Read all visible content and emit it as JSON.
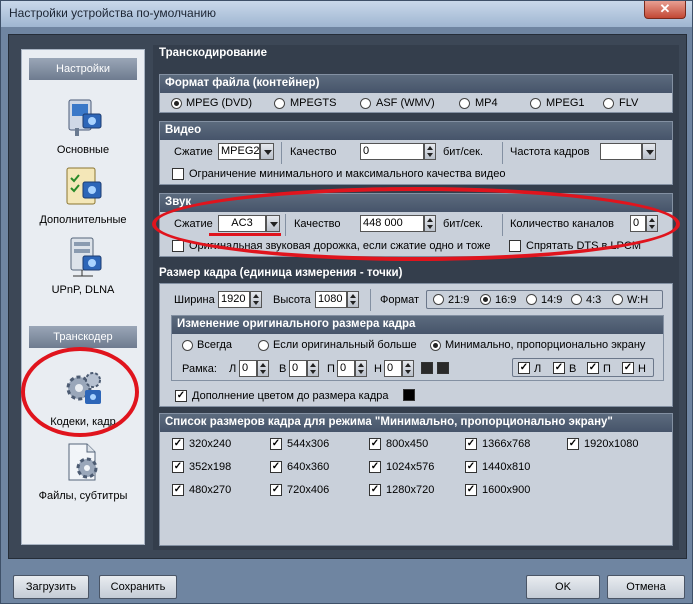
{
  "window": {
    "title": "Настройки устройства по-умолчанию",
    "close": "✕"
  },
  "sidebar": {
    "section1": "Настройки",
    "items": [
      {
        "label": "Основные",
        "icon": "media-settings-icon"
      },
      {
        "label": "Дополнительные",
        "icon": "checklist-icon"
      },
      {
        "label": "UPnP, DLNA",
        "icon": "network-server-icon"
      }
    ],
    "section2": "Транскодер",
    "items2": [
      {
        "label": "Кодеки, кадр",
        "icon": "gears-icon"
      },
      {
        "label": "Файлы, субтитры",
        "icon": "file-gear-icon"
      }
    ]
  },
  "main": {
    "title": "Транскодирование",
    "format": {
      "title": "Формат файла (контейнер)",
      "options": [
        "MPEG (DVD)",
        "MPEGTS",
        "ASF (WMV)",
        "MP4",
        "MPEG1",
        "FLV"
      ],
      "selected": "MPEG (DVD)"
    },
    "video": {
      "title": "Видео",
      "compress_label": "Сжатие",
      "compress_value": "MPEG2",
      "quality_label": "Качество",
      "quality_value": "0",
      "quality_unit": "бит/сек.",
      "fps_label": "Частота кадров",
      "fps_value": "",
      "limit_label": "Ограничение минимального и максимального качества видео",
      "limit_checked": false
    },
    "audio": {
      "title": "Звук",
      "compress_label": "Сжатие",
      "compress_value": "AC3",
      "quality_label": "Качество",
      "quality_value": "448 000",
      "quality_unit": "бит/сек.",
      "channels_label": "Количество каналов",
      "channels_value": "0",
      "orig_label": "Оригинальная звуковая дорожка, если сжатие одно и тоже",
      "orig_checked": false,
      "dts_label": "Спрятать DTS в LPCM",
      "dts_checked": false
    },
    "frame": {
      "title": "Размер кадра (единица измерения - точки)",
      "width_label": "Ширина",
      "width_value": "1920",
      "height_label": "Высота",
      "height_value": "1080",
      "format_label": "Формат",
      "ratios": [
        "21:9",
        "16:9",
        "14:9",
        "4:3",
        "W:H"
      ],
      "ratio_selected": "16:9",
      "resize": {
        "title": "Изменение оригинального размера кадра",
        "options": [
          "Всегда",
          "Если оригинальный больше",
          "Минимально, пропорционально экрану"
        ],
        "selected": "Минимально, пропорционально экрану",
        "frame_label": "Рамка:",
        "sides": [
          {
            "label": "Л",
            "value": "0"
          },
          {
            "label": "В",
            "value": "0"
          },
          {
            "label": "П",
            "value": "0"
          },
          {
            "label": "Н",
            "value": "0"
          }
        ],
        "checks": [
          {
            "label": "Л",
            "checked": true
          },
          {
            "label": "В",
            "checked": true
          },
          {
            "label": "П",
            "checked": true
          },
          {
            "label": "Н",
            "checked": true
          }
        ]
      },
      "pad_label": "Дополнение цветом до размера кадра",
      "pad_checked": true,
      "pad_color": "#000000"
    },
    "sizes": {
      "title": "Список размеров кадра для режима \"Минимально, пропорционально экрану\"",
      "items": [
        "320x240",
        "544x306",
        "800x450",
        "1366x768",
        "1920x1080",
        "352x198",
        "640x360",
        "1024x576",
        "1440x810",
        "480x270",
        "720x406",
        "1280x720",
        "1600x900"
      ]
    }
  },
  "buttons": {
    "load": "Загрузить",
    "save": "Сохранить",
    "ok": "OK",
    "cancel": "Отмена"
  },
  "colors": {
    "highlight": "#e0141d",
    "panel": "#343e4c",
    "group": "#c9d0da"
  }
}
